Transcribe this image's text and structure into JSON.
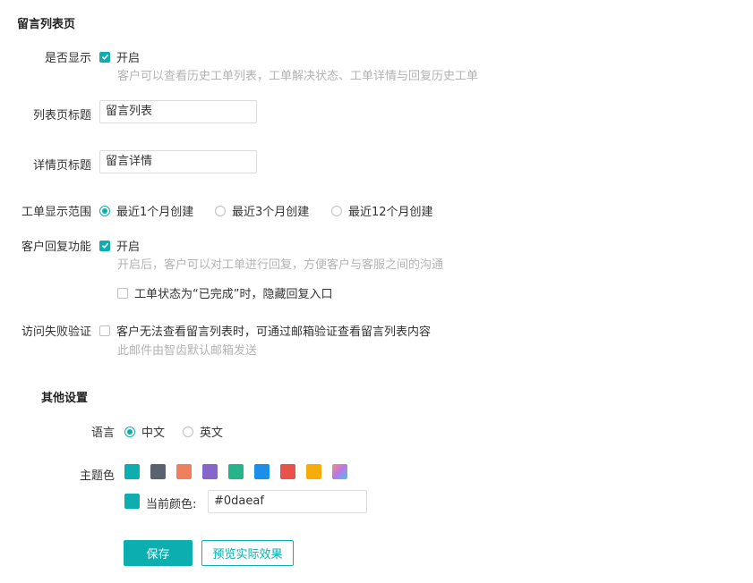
{
  "page_title": "留言列表页",
  "show": {
    "label": "是否显示",
    "option_label": "开启",
    "checked": true,
    "hint": "客户可以查看历史工单列表，工单解决状态、工单详情与回复历史工单"
  },
  "list_title": {
    "label": "列表页标题",
    "value": "留言列表"
  },
  "detail_title": {
    "label": "详情页标题",
    "value": "留言详情"
  },
  "range": {
    "label": "工单显示范围",
    "options": [
      "最近1个月创建",
      "最近3个月创建",
      "最近12个月创建"
    ],
    "selected": "最近1个月创建"
  },
  "reply": {
    "label": "客户回复功能",
    "option_label": "开启",
    "checked": true,
    "hint": "开启后，客户可以对工单进行回复，方便客户与客服之间的沟通",
    "sub_option_label": "工单状态为“已完成”时，隐藏回复入口",
    "sub_checked": false
  },
  "verify": {
    "label": "访问失败验证",
    "option_label": "客户无法查看留言列表时，可通过邮箱验证查看留言列表内容",
    "checked": false,
    "hint": "此邮件由智齿默认邮箱发送"
  },
  "other": {
    "title": "其他设置",
    "language": {
      "label": "语言",
      "options": [
        "中文",
        "英文"
      ],
      "selected": "中文"
    },
    "theme": {
      "label": "主题色",
      "swatches": [
        "#0daeaf",
        "#5a6170",
        "#ee8060",
        "#8467c9",
        "#27b38a",
        "#1a8ee8",
        "#e8524a",
        "#f6ac0c",
        "gradient"
      ],
      "current_label": "当前颜色:",
      "current_value": "#0daeaf"
    }
  },
  "buttons": {
    "save": "保存",
    "preview": "预览实际效果"
  },
  "colors": {
    "accent": "#0daeaf",
    "hint": "#b3b3b3"
  }
}
